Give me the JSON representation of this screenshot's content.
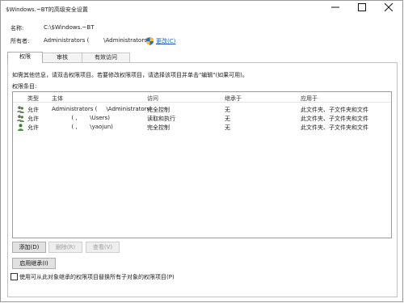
{
  "window": {
    "title": "$Windows.~BT的高级安全设置",
    "controls": {
      "minimize": "minimize",
      "maximize": "maximize",
      "close": "close"
    }
  },
  "info": {
    "name_label": "名称:",
    "name_value": "C:\\$Windows.~BT",
    "owner_label": "所有者:",
    "owner_value": "Administrators (        \\Administrators)",
    "change_link": "更改(C)"
  },
  "tabs": [
    {
      "label": "权限",
      "active": true
    },
    {
      "label": "审核",
      "active": false
    },
    {
      "label": "有效访问",
      "active": false
    }
  ],
  "panel": {
    "instruction": "如需其他信息，请双击权限项目。若要修改权限项目，请选择该项目并单击\"编辑\"(如果可用)。",
    "entries_label": "权限条目:",
    "columns": [
      "类型",
      "主体",
      "访问",
      "继承于",
      "应用于"
    ],
    "rows": [
      {
        "icon": "group-icon",
        "type": "允许",
        "principal": "Administrators (     \\Administrators)",
        "access": "完全控制",
        "inherited": "无",
        "applies": "此文件夹、子文件夹和文件"
      },
      {
        "icon": "group-icon",
        "type": "允许",
        "principal": "           ( ,       \\Users)",
        "access": "读取和执行",
        "inherited": "无",
        "applies": "此文件夹、子文件夹和文件"
      },
      {
        "icon": "user-icon",
        "type": "允许",
        "principal": "           ( ,       \\yaojun)",
        "access": "完全控制",
        "inherited": "无",
        "applies": "此文件夹、子文件夹和文件"
      }
    ],
    "buttons": {
      "add": "添加(D)",
      "remove": "删除(R)",
      "view": "查看(V)",
      "enable_inheritance": "启用继承(I)"
    },
    "replace_checkbox": "使用可从此对象继承的权限项目替换所有子对象的权限项目(P)"
  },
  "colors": {
    "link": "#1a5fb4",
    "border": "#adadad",
    "disabled_text": "#a0a0a0"
  }
}
